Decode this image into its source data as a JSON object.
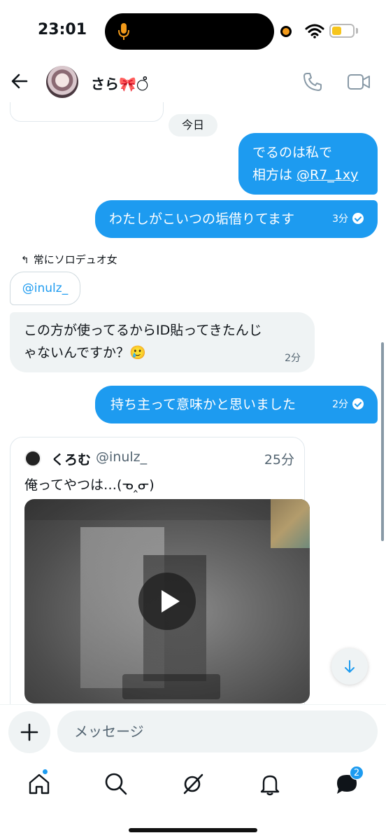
{
  "status_bar": {
    "time": "23:01"
  },
  "header": {
    "contact_name": "さら🎀○̊"
  },
  "chat": {
    "date_label": "今日",
    "messages": [
      {
        "line1": "でるのは私で",
        "line2_prefix": "相方は ",
        "line2_mention": "@R7_1xy"
      },
      {
        "text": "わたしがこいつの垢借りてます",
        "time": "3分"
      },
      {
        "reply_label": "常にソロデュオ女",
        "quoted_handle": "@inulz_"
      },
      {
        "line1": "この方が使ってるからID貼ってきたんじ",
        "line2": "ゃないんですか？🥲",
        "time": "2分"
      },
      {
        "text": "持ち主って意味かと思いました",
        "time": "2分"
      }
    ],
    "tweet": {
      "name": "くろむ",
      "handle": "@inulz_",
      "time": "25分",
      "text": "俺ってやつは…(ᓀ‸ᓂ)"
    }
  },
  "composer": {
    "placeholder": "メッセージ"
  },
  "nav": {
    "messages_badge": "2"
  },
  "colors": {
    "accent": "#1d9bf0",
    "incoming_bubble": "#eff3f4"
  }
}
